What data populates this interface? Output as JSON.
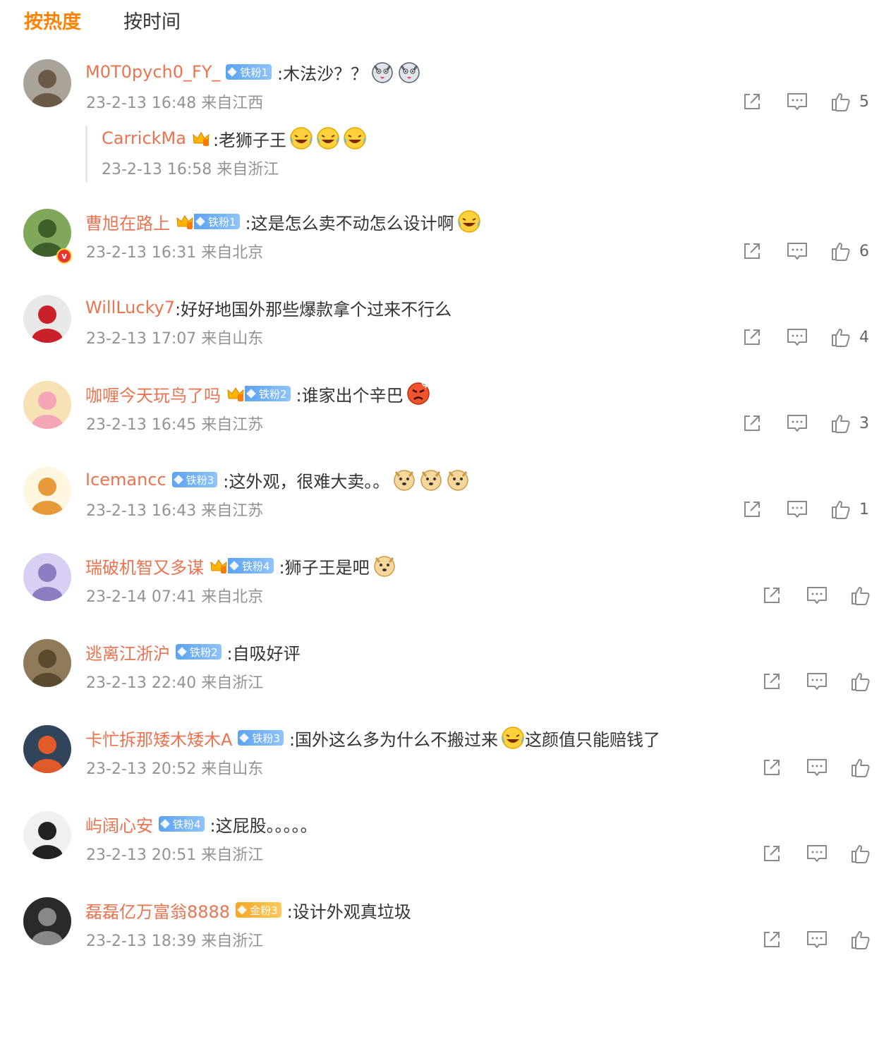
{
  "tabs": {
    "hot": "按热度",
    "time": "按时间"
  },
  "comments": [
    {
      "user": "M0T0pych0_FY_",
      "fan": "铁粉1",
      "text": ":木法沙？？",
      "time": "23-2-13 16:48 来自江西",
      "likes": "5",
      "emojis": [
        "husky-emoji",
        "husky-emoji"
      ],
      "reply": {
        "user": "CarrickMa",
        "text": ":老狮子王",
        "time": "23-2-13 16:58 来自浙江",
        "emojis": [
          "laugh-cry-emoji",
          "laugh-cry-emoji",
          "laugh-cry-emoji"
        ]
      }
    },
    {
      "user": "曹旭在路上",
      "fan": "铁粉1",
      "text": ":这是怎么卖不动怎么设计啊",
      "time": "23-2-13 16:31 来自北京",
      "likes": "6",
      "emojis": [
        "laugh-cry-emoji"
      ]
    },
    {
      "user": "WillLucky7",
      "fan": "",
      "text": ":好好地国外那些爆款拿个过来不行么",
      "time": "23-2-13 17:07 来自山东",
      "likes": "4",
      "emojis": []
    },
    {
      "user": "咖喱今天玩鸟了吗",
      "fan": "铁粉2",
      "text": ":谁家出个辛巴",
      "time": "23-2-13 16:45 来自江苏",
      "likes": "3",
      "emojis": [
        "angry-emoji"
      ]
    },
    {
      "user": "Icemancc",
      "fan": "铁粉3",
      "text": ":这外观，很难大卖。。",
      "time": "23-2-13 16:43 来自江苏",
      "likes": "1",
      "emojis": [
        "doge-emoji",
        "doge-emoji",
        "doge-emoji"
      ]
    },
    {
      "user": "瑞破机智又多谋",
      "fan": "铁粉4",
      "text": ":狮子王是吧",
      "time": "23-2-14 07:41 来自北京",
      "likes": "",
      "emojis": [
        "doge-emoji"
      ]
    },
    {
      "user": "逃离江浙沪",
      "fan": "铁粉2",
      "text": ":自吸好评",
      "time": "23-2-13 22:40 来自浙江",
      "likes": "",
      "emojis": []
    },
    {
      "user": "卡忙拆那矮木矮木A",
      "fan": "铁粉3",
      "text": ":国外这么多为什么不搬过来",
      "text2": "这颜值只能赔钱了",
      "time": "23-2-13 20:52 来自山东",
      "likes": "",
      "emojis": [
        "laugh-cry-emoji"
      ]
    },
    {
      "user": "屿阔心安",
      "fan": "铁粉4",
      "text": ":这屁股。。。。。",
      "time": "23-2-13 20:51 来自浙江",
      "likes": "",
      "emojis": []
    },
    {
      "user": "磊磊亿万富翁8888",
      "fan": "金粉3",
      "text": ":设计外观真垃圾",
      "time": "23-2-13 18:39 来自浙江",
      "likes": "",
      "emojis": []
    }
  ],
  "colors": {
    "accent": "#ff8200",
    "username": "#eb7350",
    "meta": "#939393",
    "fan_badge": "#5ba3f2",
    "gold_badge": "#f5a623"
  }
}
